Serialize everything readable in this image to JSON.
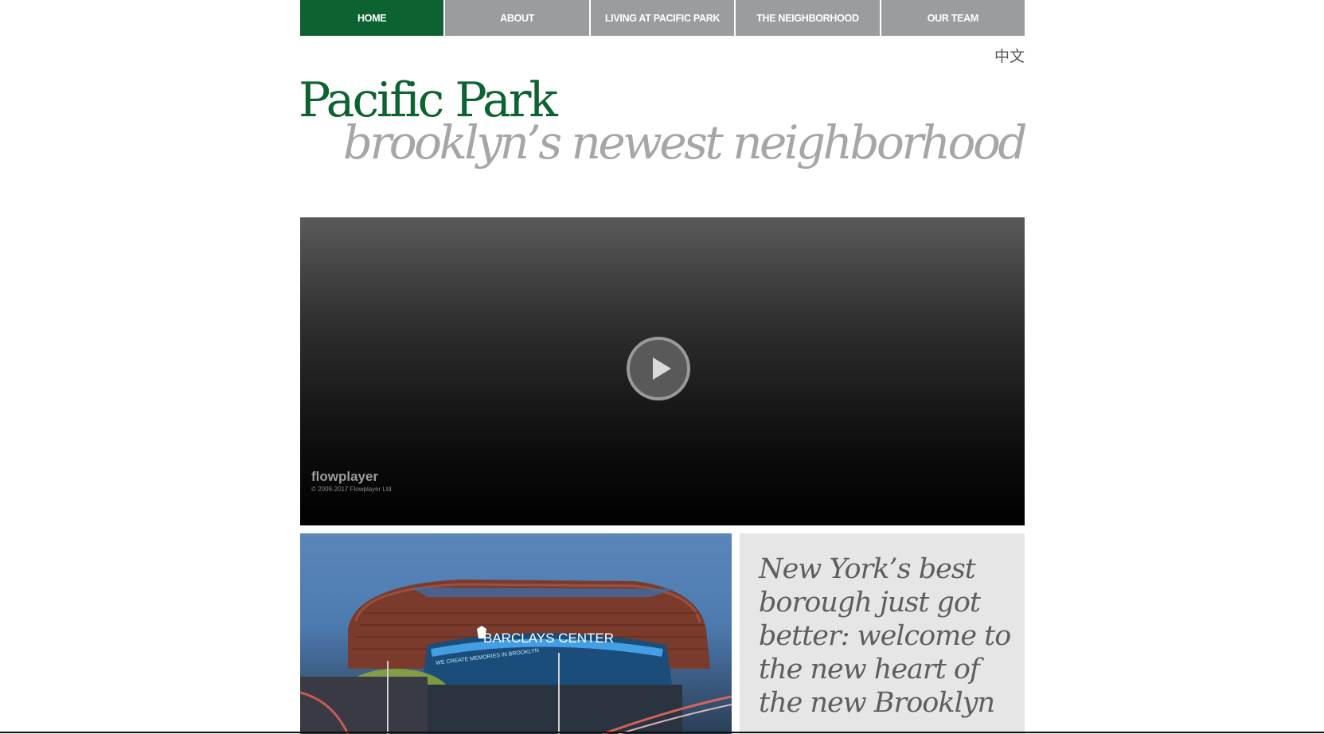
{
  "nav": {
    "items": [
      {
        "label": "HOME"
      },
      {
        "label": "ABOUT"
      },
      {
        "label": "LIVING AT PACIFIC PARK"
      },
      {
        "label": "THE NEIGHBORHOOD"
      },
      {
        "label": "OUR TEAM"
      }
    ],
    "active_index": 0
  },
  "language_link": "中文",
  "logo": {
    "title": "Pacific Park",
    "tagline": "brooklyn’s newest neighborhood"
  },
  "video": {
    "brand": "flowplayer",
    "copyright": "© 2008-2017 Flowplayer Ltd",
    "play_icon": "play-icon"
  },
  "photo": {
    "label": "BARCLAYS CENTER",
    "sublabel": "WE CREATE MEMORIES IN BROOKLYN"
  },
  "panel": {
    "text": "New York’s best borough just got better: welcome to the new heart of the new Brooklyn"
  },
  "colors": {
    "brand_green": "#0d6232",
    "nav_gray": "#9b9c9f",
    "tagline_gray": "#a6a6a6",
    "panel_bg": "#e6e6e6"
  }
}
